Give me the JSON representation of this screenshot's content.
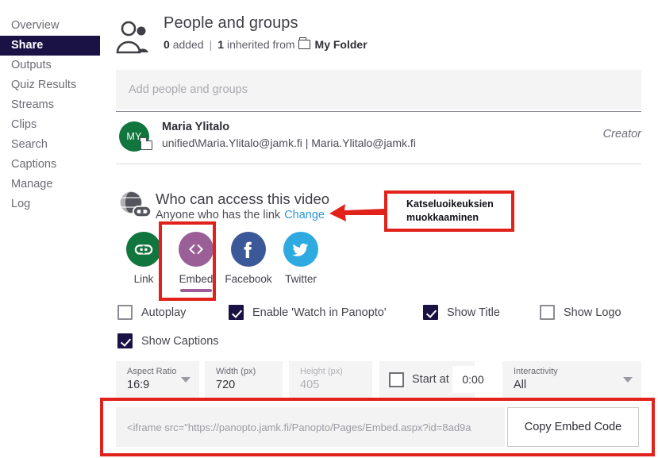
{
  "sidebar": {
    "items": [
      {
        "label": "Overview",
        "active": false
      },
      {
        "label": "Share",
        "active": true
      },
      {
        "label": "Outputs",
        "active": false
      },
      {
        "label": "Quiz Results",
        "active": false
      },
      {
        "label": "Streams",
        "active": false
      },
      {
        "label": "Clips",
        "active": false
      },
      {
        "label": "Search",
        "active": false
      },
      {
        "label": "Captions",
        "active": false
      },
      {
        "label": "Manage",
        "active": false
      },
      {
        "label": "Log",
        "active": false
      }
    ]
  },
  "people": {
    "title": "People and groups",
    "added_count": "0",
    "added_label": "added",
    "separator": "|",
    "inherited_count": "1",
    "inherited_label": "inherited from",
    "folder_name": "My Folder",
    "add_placeholder": "Add people and groups",
    "add_value": "",
    "user": {
      "initials": "MY",
      "name": "Maria Ylitalo",
      "email": "unified\\Maria.Ylitalo@jamk.fi | Maria.Ylitalo@jamk.fi",
      "role": "Creator"
    }
  },
  "access": {
    "title": "Who can access this video",
    "current": "Anyone who has the link",
    "change_label": "Change",
    "share_buttons": [
      {
        "label": "Link",
        "icon": "link-icon",
        "color": "#11753e",
        "selected": false
      },
      {
        "label": "Embed",
        "icon": "code-icon",
        "color": "#9a5f97",
        "selected": true
      },
      {
        "label": "Facebook",
        "icon": "facebook-icon",
        "color": "#3b5998",
        "selected": false
      },
      {
        "label": "Twitter",
        "icon": "twitter-icon",
        "color": "#2eaae1",
        "selected": false
      }
    ]
  },
  "options": {
    "checkboxes": [
      {
        "label": "Autoplay",
        "checked": false
      },
      {
        "label": "Enable 'Watch in Panopto'",
        "checked": true
      },
      {
        "label": "Show Title",
        "checked": true
      },
      {
        "label": "Show Logo",
        "checked": false
      },
      {
        "label": "Show Captions",
        "checked": true
      }
    ]
  },
  "fields": {
    "aspect_ratio": {
      "label": "Aspect Ratio",
      "value": "16:9"
    },
    "width": {
      "label": "Width (px)",
      "value": "720"
    },
    "height": {
      "label": "Height (px)",
      "value": "405"
    },
    "start_at": {
      "label": "Start at",
      "checked": false,
      "time": "0:00"
    },
    "interactivity": {
      "label": "Interactivity",
      "value": "All"
    }
  },
  "embed": {
    "code": "<iframe src=\"https://panopto.jamk.fi/Panopto/Pages/Embed.aspx?id=8ad9a",
    "copy_label": "Copy Embed Code"
  },
  "annotations": {
    "note_line1": "Katseluoikeuksien",
    "note_line2": "muokkaaminen",
    "color": "#e0221b"
  }
}
